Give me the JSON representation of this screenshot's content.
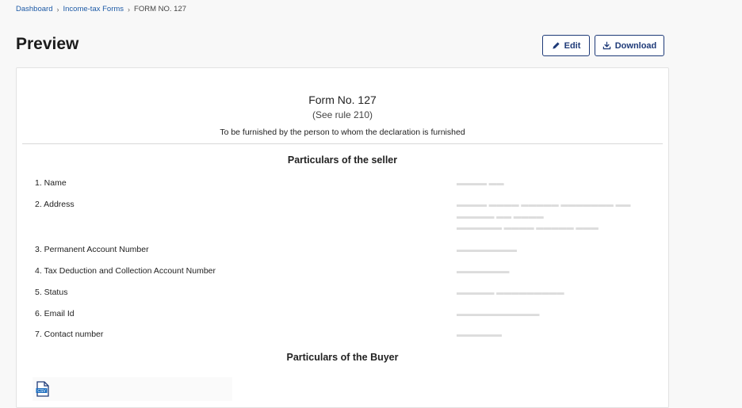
{
  "breadcrumb": {
    "items": [
      "Dashboard",
      "Income-tax Forms"
    ],
    "current": "FORM NO. 127",
    "separator": "›"
  },
  "page": {
    "title": "Preview"
  },
  "toolbar": {
    "edit_label": "Edit",
    "download_label": "Download"
  },
  "form": {
    "title": "Form No. 127",
    "subtitle": "(See rule 210)",
    "note": "To be furnished by the person to whom the declaration is furnished",
    "seller_heading": "Particulars of the seller",
    "buyer_heading": "Particulars of the Buyer",
    "fields": [
      {
        "label": "1. Name"
      },
      {
        "label": "2. Address"
      },
      {
        "label": "3. Permanent Account Number"
      },
      {
        "label": "4. Tax Deduction and Collection Account Number"
      },
      {
        "label": "5. Status"
      },
      {
        "label": "6. Email Id"
      },
      {
        "label": "7. Contact number"
      }
    ]
  },
  "colors": {
    "accent": "#1e3a78",
    "link": "#1d5aa6"
  },
  "icons": {
    "edit": "pencil-icon",
    "download": "download-icon",
    "file": "csv-file-icon"
  }
}
